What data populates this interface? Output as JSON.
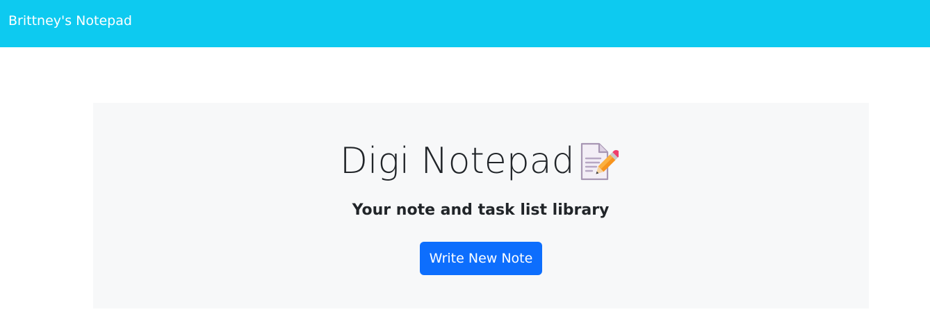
{
  "navbar": {
    "brand": "Brittney's Notepad",
    "background_color": "#0dcaf0"
  },
  "hero": {
    "title": "Digi Notepad",
    "title_icon": "memo-icon",
    "subtitle": "Your note and task list library",
    "cta_label": "Write New Note",
    "cta_color": "#0d6efd",
    "background_color": "#f7f8f9"
  }
}
